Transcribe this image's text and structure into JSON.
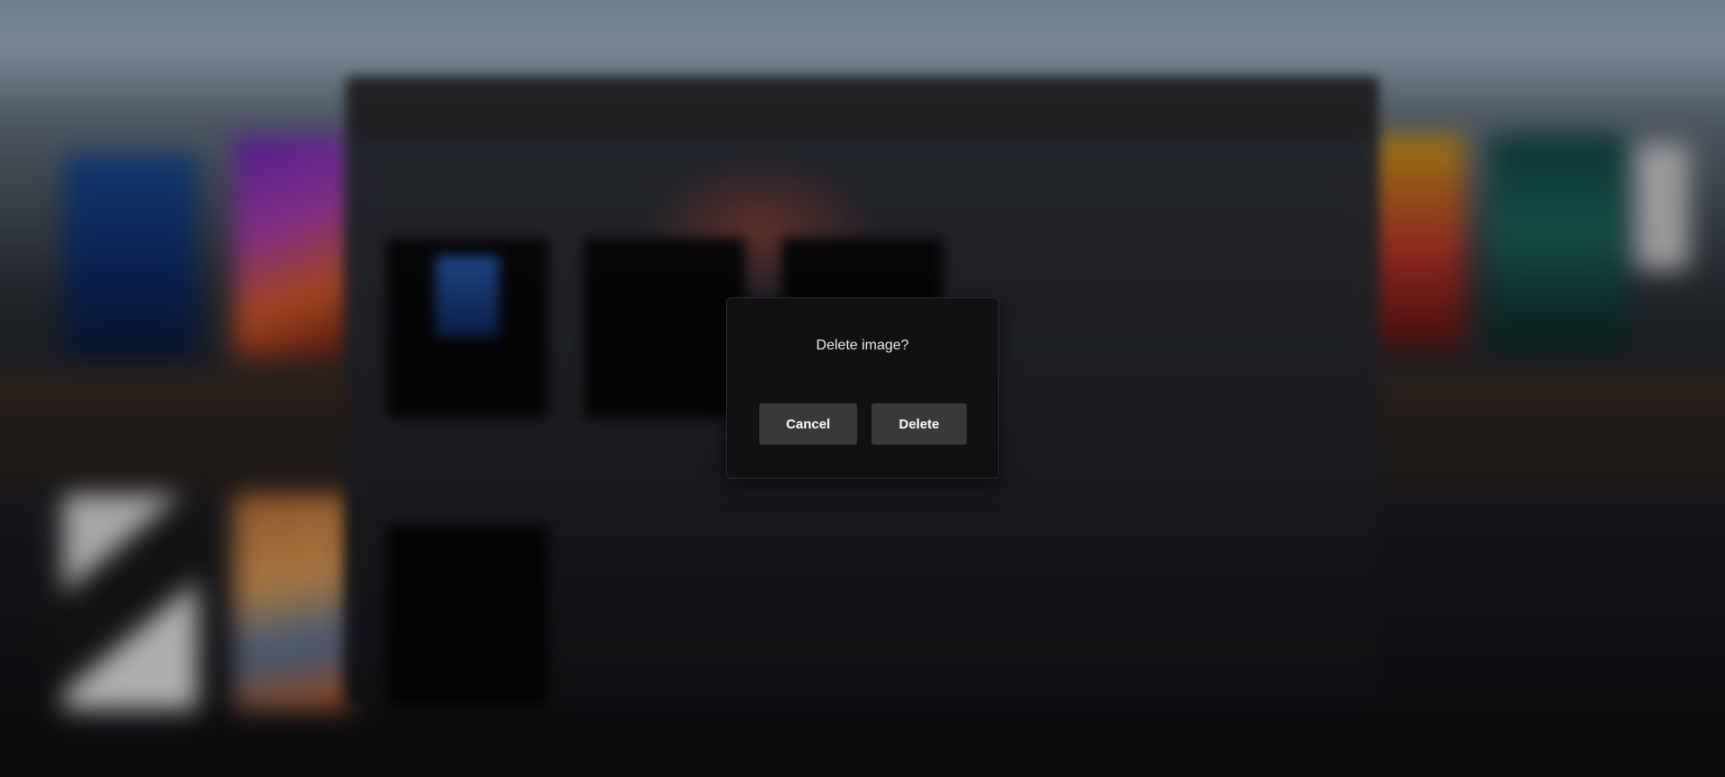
{
  "dialog": {
    "title": "Delete image?",
    "cancel_label": "Cancel",
    "delete_label": "Delete"
  }
}
